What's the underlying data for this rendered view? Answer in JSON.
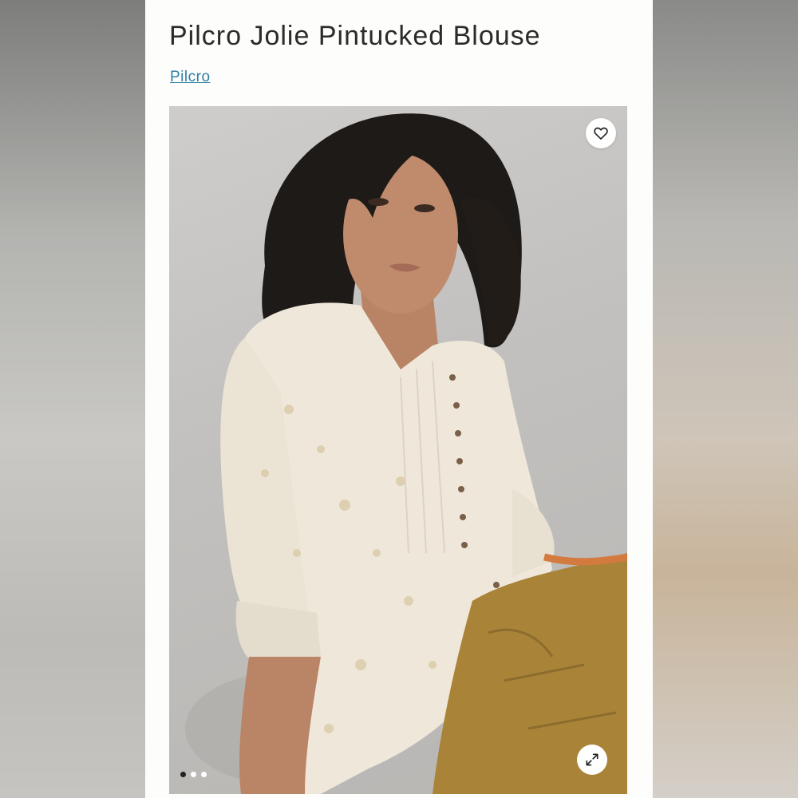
{
  "product": {
    "title": "Pilcro Jolie Pintucked Blouse",
    "brand": "Pilcro"
  },
  "gallery": {
    "favorite_icon": "heart-outline-icon",
    "expand_icon": "expand-diagonal-arrows-icon",
    "image_count": 3,
    "active_index": 0
  },
  "colors": {
    "link": "#2f7fa6",
    "title": "#2b2b2b",
    "dot_active": "#222222",
    "dot_inactive": "#ffffff"
  }
}
